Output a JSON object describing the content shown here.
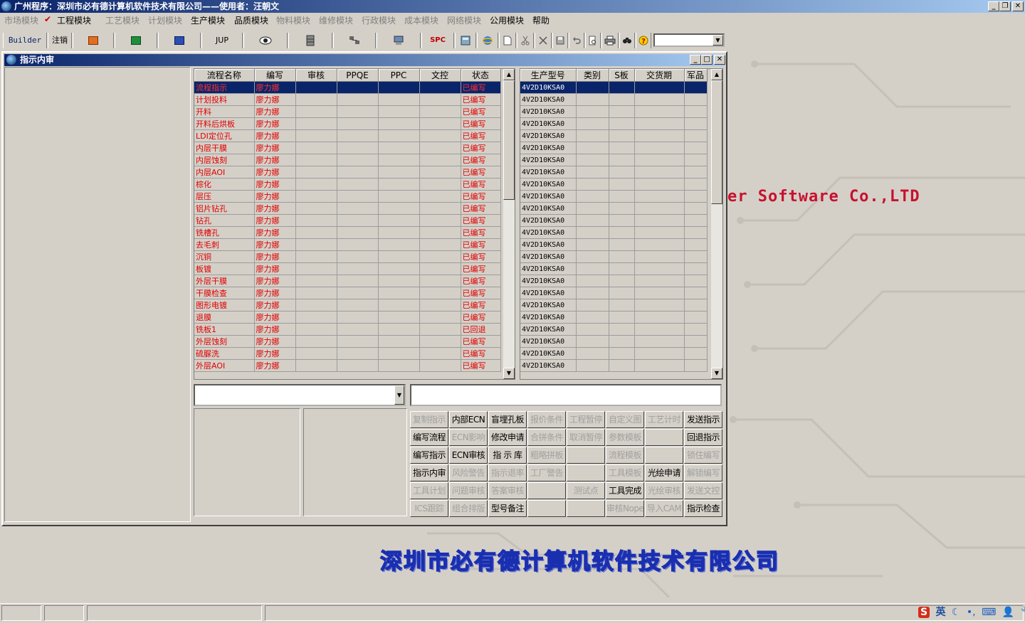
{
  "app": {
    "title": "广州程序：深圳市必有德计算机软件技术有限公司——使用者：汪朝文",
    "window_controls": {
      "minimize": "_",
      "restore": "❐",
      "close": "✕"
    }
  },
  "menu": [
    {
      "label": "市场模块",
      "enabled": false
    },
    {
      "label": "✔",
      "check": true
    },
    {
      "label": "工程模块",
      "enabled": true
    },
    {
      "label": "工艺模块",
      "enabled": false
    },
    {
      "label": "计划模块",
      "enabled": false
    },
    {
      "label": "生产模块",
      "enabled": true
    },
    {
      "label": "品质模块",
      "enabled": true
    },
    {
      "label": "物料模块",
      "enabled": false
    },
    {
      "label": "维修模块",
      "enabled": false
    },
    {
      "label": "行政模块",
      "enabled": false
    },
    {
      "label": "成本模块",
      "enabled": false
    },
    {
      "label": "网络模块",
      "enabled": false
    },
    {
      "label": "公用模块",
      "enabled": true
    },
    {
      "label": "帮助",
      "enabled": true
    }
  ],
  "toolbar": {
    "builder": "Builder",
    "logout": "注销",
    "jup": "JUP",
    "spc": "SPC",
    "icons": [
      "powerpoint-icon",
      "excel-icon",
      "word-icon",
      "eye-icon",
      "database-icon",
      "network-icon",
      "computer-icon",
      "calculator-icon",
      "ie-icon",
      "new-file-icon",
      "cut-icon",
      "delete-icon",
      "save-icon",
      "undo-icon",
      "preview-icon",
      "print-icon",
      "find-icon",
      "help-icon"
    ]
  },
  "inner_window": {
    "title": "指示内审",
    "controls": {
      "minimize": "_",
      "restore": "□",
      "close": "✕"
    }
  },
  "process_grid": {
    "columns": [
      "流程名称",
      "编写",
      "审核",
      "PPQE",
      "PPC",
      "文控",
      "状态"
    ],
    "selected_index": 0,
    "rows": [
      [
        "流程指示",
        "廖力娜",
        "",
        "",
        "",
        "",
        "已编写"
      ],
      [
        "计划投料",
        "廖力娜",
        "",
        "",
        "",
        "",
        "已编写"
      ],
      [
        "开料",
        "廖力娜",
        "",
        "",
        "",
        "",
        "已编写"
      ],
      [
        "开料后烘板",
        "廖力娜",
        "",
        "",
        "",
        "",
        "已编写"
      ],
      [
        "LDI定位孔",
        "廖力娜",
        "",
        "",
        "",
        "",
        "已编写"
      ],
      [
        "内层干膜",
        "廖力娜",
        "",
        "",
        "",
        "",
        "已编写"
      ],
      [
        "内层蚀刻",
        "廖力娜",
        "",
        "",
        "",
        "",
        "已编写"
      ],
      [
        "内层AOI",
        "廖力娜",
        "",
        "",
        "",
        "",
        "已编写"
      ],
      [
        "棕化",
        "廖力娜",
        "",
        "",
        "",
        "",
        "已编写"
      ],
      [
        "层压",
        "廖力娜",
        "",
        "",
        "",
        "",
        "已编写"
      ],
      [
        "铝片钻孔",
        "廖力娜",
        "",
        "",
        "",
        "",
        "已编写"
      ],
      [
        "钻孔",
        "廖力娜",
        "",
        "",
        "",
        "",
        "已编写"
      ],
      [
        "铣槽孔",
        "廖力娜",
        "",
        "",
        "",
        "",
        "已编写"
      ],
      [
        "去毛刺",
        "廖力娜",
        "",
        "",
        "",
        "",
        "已编写"
      ],
      [
        "沉铜",
        "廖力娜",
        "",
        "",
        "",
        "",
        "已编写"
      ],
      [
        "板镀",
        "廖力娜",
        "",
        "",
        "",
        "",
        "已编写"
      ],
      [
        "外层干膜",
        "廖力娜",
        "",
        "",
        "",
        "",
        "已编写"
      ],
      [
        "干膜检查",
        "廖力娜",
        "",
        "",
        "",
        "",
        "已编写"
      ],
      [
        "图形电镀",
        "廖力娜",
        "",
        "",
        "",
        "",
        "已编写"
      ],
      [
        "退膜",
        "廖力娜",
        "",
        "",
        "",
        "",
        "已编写"
      ],
      [
        "铣板1",
        "廖力娜",
        "",
        "",
        "",
        "",
        "已回退"
      ],
      [
        "外层蚀刻",
        "廖力娜",
        "",
        "",
        "",
        "",
        "已编写"
      ],
      [
        "硫脲洗",
        "廖力娜",
        "",
        "",
        "",
        "",
        "已编写"
      ],
      [
        "外层AOI",
        "廖力娜",
        "",
        "",
        "",
        "",
        "已编写"
      ]
    ]
  },
  "model_grid": {
    "columns": [
      "生产型号",
      "类别",
      "S板",
      "交货期",
      "军品"
    ],
    "selected_index": 0,
    "rows": [
      [
        "4V2D10KSA0"
      ],
      [
        "4V2D10KSA0"
      ],
      [
        "4V2D10KSA0"
      ],
      [
        "4V2D10KSA0"
      ],
      [
        "4V2D10KSA0"
      ],
      [
        "4V2D10KSA0"
      ],
      [
        "4V2D10KSA0"
      ],
      [
        "4V2D10KSA0"
      ],
      [
        "4V2D10KSA0"
      ],
      [
        "4V2D10KSA0"
      ],
      [
        "4V2D10KSA0"
      ],
      [
        "4V2D10KSA0"
      ],
      [
        "4V2D10KSA0"
      ],
      [
        "4V2D10KSA0"
      ],
      [
        "4V2D10KSA0"
      ],
      [
        "4V2D10KSA0"
      ],
      [
        "4V2D10KSA0"
      ],
      [
        "4V2D10KSA0"
      ],
      [
        "4V2D10KSA0"
      ],
      [
        "4V2D10KSA0"
      ],
      [
        "4V2D10KSA0"
      ],
      [
        "4V2D10KSA0"
      ],
      [
        "4V2D10KSA0"
      ],
      [
        "4V2D10KSA0"
      ]
    ]
  },
  "scroll_glyphs": {
    "up": "▲",
    "down": "▼"
  },
  "combo_arrow": "▼",
  "buttons": [
    [
      {
        "label": "复制指示",
        "enabled": false
      },
      {
        "label": "内部ECN",
        "enabled": true
      },
      {
        "label": "盲埋孔板",
        "enabled": true
      },
      {
        "label": "报价条件",
        "enabled": false
      },
      {
        "label": "工程暂停",
        "enabled": false
      },
      {
        "label": "自定义图",
        "enabled": false
      },
      {
        "label": "工艺计时",
        "enabled": false
      },
      {
        "label": "发送指示",
        "enabled": true
      }
    ],
    [
      {
        "label": "编写流程",
        "enabled": true
      },
      {
        "label": "ECN影响",
        "enabled": false
      },
      {
        "label": "修改申请",
        "enabled": true
      },
      {
        "label": "合拼条件",
        "enabled": false
      },
      {
        "label": "取消暂停",
        "enabled": false
      },
      {
        "label": "参数模板",
        "enabled": false
      },
      {
        "label": "",
        "enabled": false
      },
      {
        "label": "回退指示",
        "enabled": true
      }
    ],
    [
      {
        "label": "编写指示",
        "enabled": true
      },
      {
        "label": "ECN审核",
        "enabled": true
      },
      {
        "label": "指 示 库",
        "enabled": true
      },
      {
        "label": "粗略拼板",
        "enabled": false
      },
      {
        "label": "",
        "enabled": false
      },
      {
        "label": "流程模板",
        "enabled": false
      },
      {
        "label": "",
        "enabled": false
      },
      {
        "label": "锁住编写",
        "enabled": false
      }
    ],
    [
      {
        "label": "指示内审",
        "enabled": true
      },
      {
        "label": "风险警告",
        "enabled": false
      },
      {
        "label": "指示退率",
        "enabled": false
      },
      {
        "label": "工厂警告",
        "enabled": false
      },
      {
        "label": "",
        "enabled": false
      },
      {
        "label": "工具模板",
        "enabled": false
      },
      {
        "label": "光绘申请",
        "enabled": true
      },
      {
        "label": "解锁编写",
        "enabled": false
      }
    ],
    [
      {
        "label": "工具计划",
        "enabled": false
      },
      {
        "label": "问题审核",
        "enabled": false
      },
      {
        "label": "答案审核",
        "enabled": false
      },
      {
        "label": "",
        "enabled": false
      },
      {
        "label": "测试点",
        "enabled": false
      },
      {
        "label": "工具完成",
        "enabled": true
      },
      {
        "label": "光绘审核",
        "enabled": false
      },
      {
        "label": "发送文控",
        "enabled": false
      }
    ],
    [
      {
        "label": "ICS跟踪",
        "enabled": false
      },
      {
        "label": "组合排版",
        "enabled": false
      },
      {
        "label": "型号备注",
        "enabled": true
      },
      {
        "label": "",
        "enabled": false
      },
      {
        "label": "",
        "enabled": false
      },
      {
        "label": "审核Nope",
        "enabled": false
      },
      {
        "label": "导入CAM",
        "enabled": false
      },
      {
        "label": "指示检查",
        "enabled": true
      }
    ]
  ],
  "background": {
    "company_en": "er Software Co.,LTD",
    "company_cn": "深圳市必有德计算机软件技术有限公司"
  },
  "tray": {
    "ime": "S",
    "lang": "英",
    "moon": "☾",
    "punct": "•,",
    "keyboard": "⌨",
    "user": "👤",
    "tools": "🔧"
  },
  "colors": {
    "title_start": "#0a246a",
    "title_end": "#a6caf0",
    "text_red": "#e00000",
    "selection": "#0a246a"
  }
}
